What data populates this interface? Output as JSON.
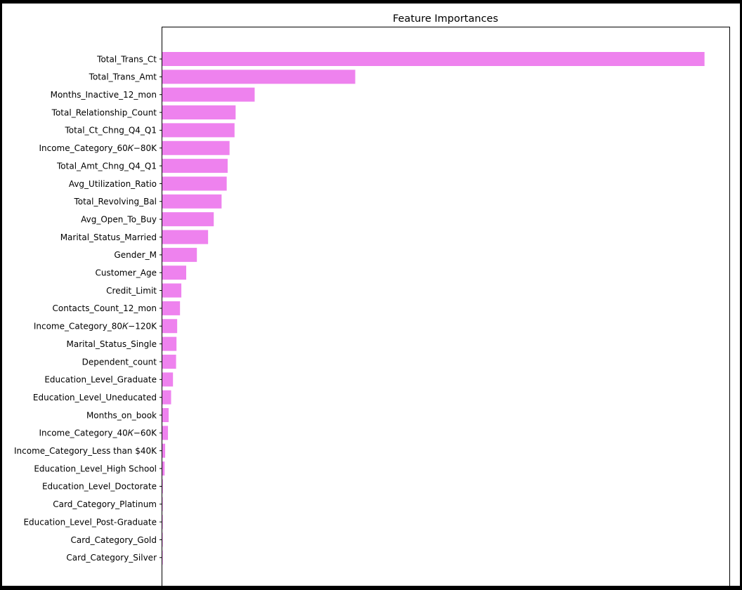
{
  "chart_data": {
    "type": "bar",
    "orientation": "horizontal",
    "title": "Feature Importances",
    "xlabel": "",
    "ylabel": "",
    "xlim": [
      0,
      0.42
    ],
    "grid": false,
    "bar_color": "#ee82ee",
    "categories": [
      "Total_Trans_Ct",
      "Total_Trans_Amt",
      "Months_Inactive_12_mon",
      "Total_Relationship_Count",
      "Total_Ct_Chng_Q4_Q1",
      "Income_Category_$60K - $80K",
      "Total_Amt_Chng_Q4_Q1",
      "Avg_Utilization_Ratio",
      "Total_Revolving_Bal",
      "Avg_Open_To_Buy",
      "Marital_Status_Married",
      "Gender_M",
      "Customer_Age",
      "Credit_Limit",
      "Contacts_Count_12_mon",
      "Income_Category_$80K - $120K",
      "Marital_Status_Single",
      "Dependent_count",
      "Education_Level_Graduate",
      "Education_Level_Uneducated",
      "Months_on_book",
      "Income_Category_$40K - $60K",
      "Income_Category_Less than $40K",
      "Education_Level_High School",
      "Education_Level_Doctorate",
      "Card_Category_Platinum",
      "Education_Level_Post-Graduate",
      "Card_Category_Gold",
      "Card_Category_Silver"
    ],
    "tick_labels": [
      "Total_Trans_Ct",
      "Total_Trans_Amt",
      "Months_Inactive_12_mon",
      "Total_Relationship_Count",
      "Total_Ct_Chng_Q4_Q1",
      "Income_Category_60𝐾−80K",
      "Total_Amt_Chng_Q4_Q1",
      "Avg_Utilization_Ratio",
      "Total_Revolving_Bal",
      "Avg_Open_To_Buy",
      "Marital_Status_Married",
      "Gender_M",
      "Customer_Age",
      "Credit_Limit",
      "Contacts_Count_12_mon",
      "Income_Category_80𝐾−120K",
      "Marital_Status_Single",
      "Dependent_count",
      "Education_Level_Graduate",
      "Education_Level_Uneducated",
      "Months_on_book",
      "Income_Category_40𝐾−60K",
      "Income_Category_Less than $40K",
      "Education_Level_High School",
      "Education_Level_Doctorate",
      "Card_Category_Platinum",
      "Education_Level_Post-Graduate",
      "Card_Category_Gold",
      "Card_Category_Silver"
    ],
    "values": [
      0.4016,
      0.1429,
      0.0684,
      0.0543,
      0.0535,
      0.0498,
      0.0484,
      0.0477,
      0.0439,
      0.0381,
      0.0339,
      0.0256,
      0.0177,
      0.0141,
      0.0131,
      0.011,
      0.0105,
      0.0102,
      0.0079,
      0.0065,
      0.0047,
      0.0042,
      0.0021,
      0.0017,
      0.0004,
      0.0003,
      0.0002,
      0.0001,
      0.0001
    ]
  }
}
